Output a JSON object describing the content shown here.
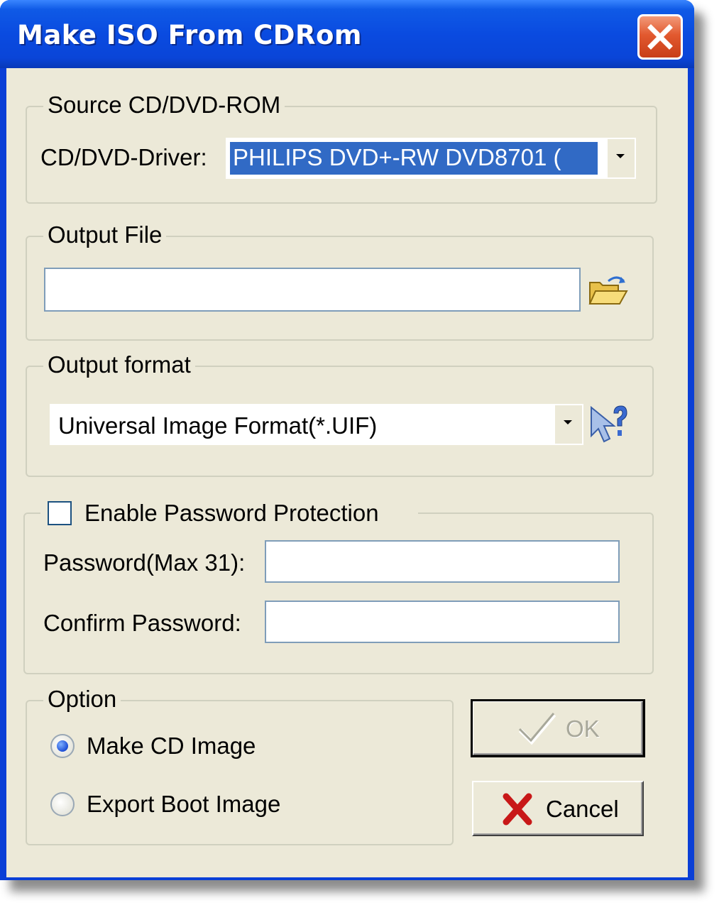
{
  "window": {
    "title": "Make ISO From CDRom"
  },
  "source": {
    "legend": "Source CD/DVD-ROM",
    "driver_label": "CD/DVD-Driver:",
    "driver_value": "PHILIPS DVD+-RW DVD8701  ("
  },
  "output_file": {
    "legend": "Output File",
    "value": ""
  },
  "output_format": {
    "legend": "Output format",
    "selected": "Universal Image Format(*.UIF)"
  },
  "password": {
    "enable_label": "Enable Password Protection",
    "enabled": false,
    "password_label": "Password(Max 31):",
    "confirm_label": "Confirm Password:",
    "password_value": "",
    "confirm_value": ""
  },
  "option": {
    "legend": "Option",
    "make_cd_label": "Make CD Image",
    "export_boot_label": "Export Boot Image",
    "selected": "Make CD Image"
  },
  "buttons": {
    "ok_label": "OK",
    "cancel_label": "Cancel"
  },
  "icons": {
    "close": "close-icon",
    "open_folder": "open-folder-icon",
    "help": "help-pointer-icon",
    "ok": "checkmark-icon",
    "cancel": "red-x-icon"
  },
  "colors": {
    "titlebar": "#0a4be0",
    "dialog_bg": "#ece9d8",
    "selection": "#316ac5",
    "close_button": "#e2592f"
  }
}
